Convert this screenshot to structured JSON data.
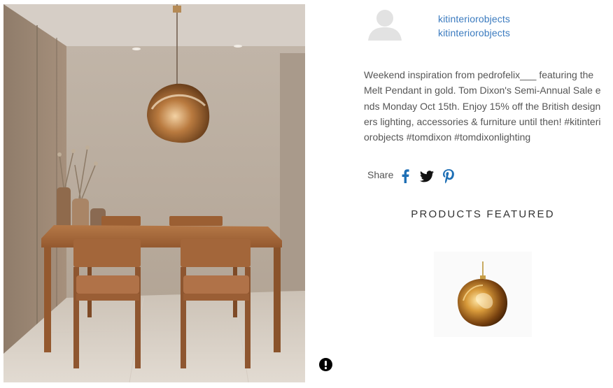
{
  "post": {
    "author_name": "kitinteriorobjects",
    "author_handle": "kitinteriorobjects",
    "caption": "Weekend inspiration from pedrofelix___ featuring the Melt Pendant in gold. Tom Dixon's Semi-Annual Sale ends Monday Oct 15th. Enjoy 15% off the British designers lighting, accessories & furniture until then! #kitinteriorobjects #tomdixon #tomdixonlighting"
  },
  "share": {
    "label": "Share",
    "icons": [
      "facebook-icon",
      "twitter-icon",
      "pinterest-icon"
    ]
  },
  "featured": {
    "title": "PRODUCTS FEATURED"
  },
  "colors": {
    "link": "#3b7bbf",
    "text": "#555555",
    "share_icons": "#1e6fb5",
    "wall": "#b5a89a",
    "wood": "#a86a3e"
  }
}
